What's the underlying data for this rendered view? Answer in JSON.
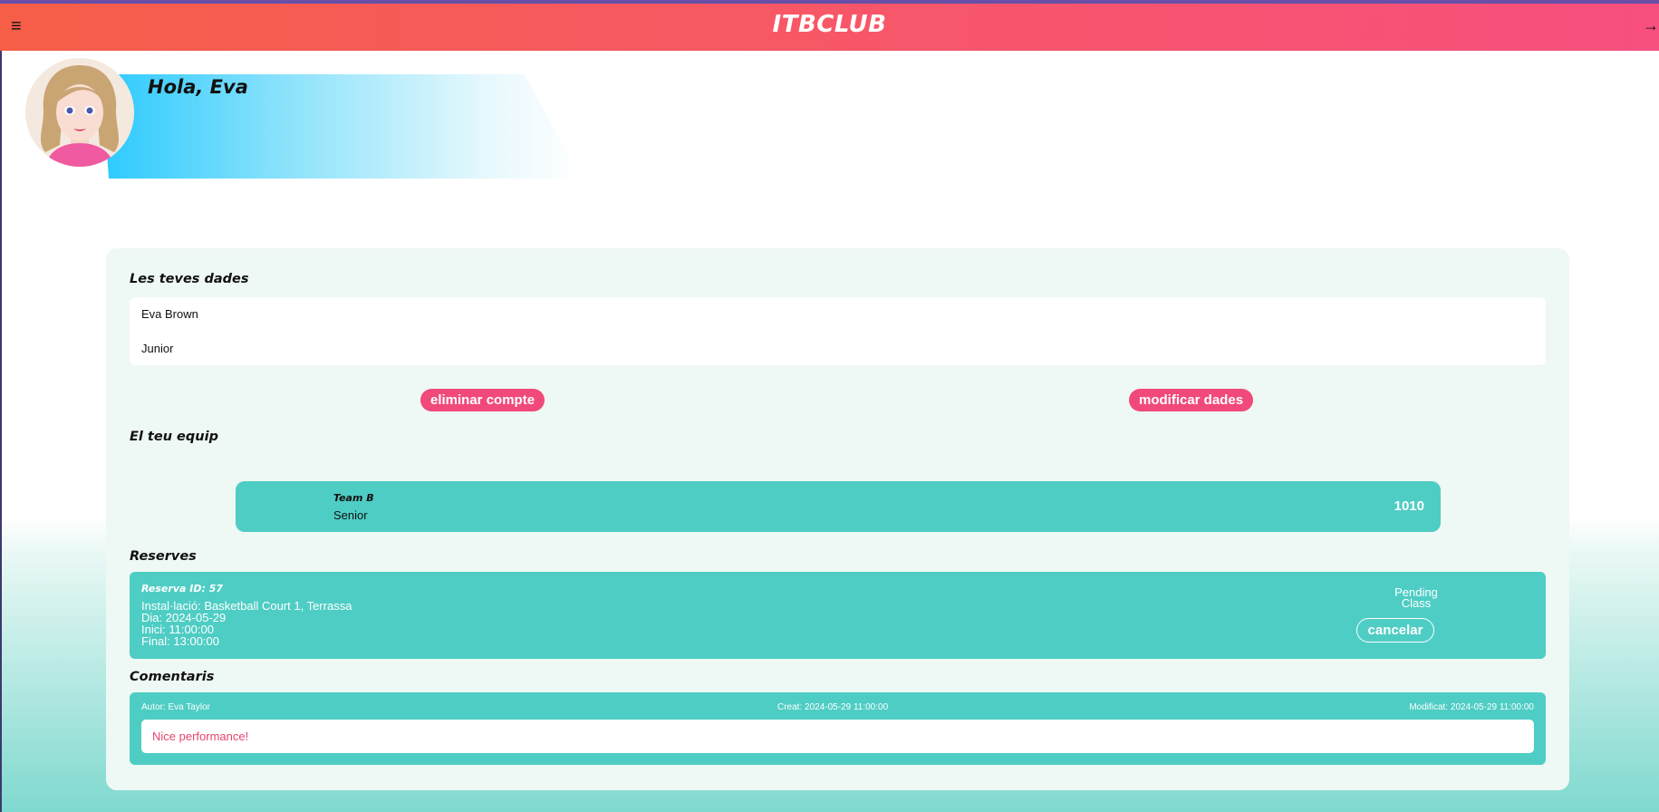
{
  "header": {
    "menu_icon": "≡",
    "title": "ITBCLUB",
    "logout_icon": "→"
  },
  "profile": {
    "greeting": "Hola, Eva",
    "avatar": "woman-avatar-illustration"
  },
  "data_section": {
    "title": "Les teves dades",
    "name": "Eva Brown",
    "category": "Junior",
    "delete_label": "eliminar compte",
    "modify_label": "modificar dades"
  },
  "team_section": {
    "title": "El teu equip",
    "team_name": "Team B",
    "team_category": "Senior",
    "team_number": "1010"
  },
  "reservations": {
    "title": "Reserves",
    "items": [
      {
        "id_label": "Reserva ID: 57",
        "facility": "Instal·lació: Basketball Court 1, Terrassa",
        "day": "Dia: 2024-05-29",
        "start": "Inici: 11:00:00",
        "end": "Final: 13:00:00",
        "status": "Pending",
        "type": "Class",
        "cancel_label": "cancelar"
      }
    ]
  },
  "comments": {
    "title": "Comentaris",
    "items": [
      {
        "author": "Autor: Eva Taylor",
        "created": "Creat: 2024-05-29 11:00:00",
        "modified": "Modificat: 2024-05-29 11:00:00",
        "text": "Nice performance!"
      }
    ]
  },
  "colors": {
    "header_start": "#f75e48",
    "header_end": "#f74f7e",
    "accent_pink": "#f0497a",
    "card_teal": "#4ecdc4",
    "panel_bg": "#eef8f4",
    "greeting_blue": "#2ccaff"
  }
}
